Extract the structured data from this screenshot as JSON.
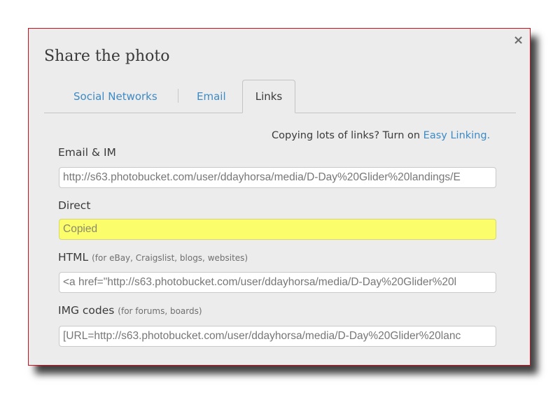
{
  "dialog": {
    "title": "Share the photo",
    "close_glyph": "×",
    "accent_border_color": "#c8101e"
  },
  "tabs": [
    {
      "label": "Social Networks",
      "active": false
    },
    {
      "label": "Email",
      "active": false
    },
    {
      "label": "Links",
      "active": true
    }
  ],
  "hint": {
    "text": "Copying lots of links? Turn on ",
    "link": "Easy Linking."
  },
  "fields": {
    "email_im": {
      "label": "Email & IM",
      "value": "http://s63.photobucket.com/user/ddayhorsa/media/D-Day%20Glider%20landings/E"
    },
    "direct": {
      "label": "Direct",
      "value": "Copied",
      "highlight_color": "#fbfd6b"
    },
    "html": {
      "label": "HTML",
      "sub": "(for eBay, Craigslist, blogs, websites)",
      "value": "<a href=\"http://s63.photobucket.com/user/ddayhorsa/media/D-Day%20Glider%20l"
    },
    "img": {
      "label": "IMG codes",
      "sub": "(for forums, boards)",
      "value": "[URL=http://s63.photobucket.com/user/ddayhorsa/media/D-Day%20Glider%20lanc"
    }
  },
  "colors": {
    "link": "#3d8ac4",
    "text": "#3a3a3a",
    "dialog_bg": "#ececec"
  }
}
